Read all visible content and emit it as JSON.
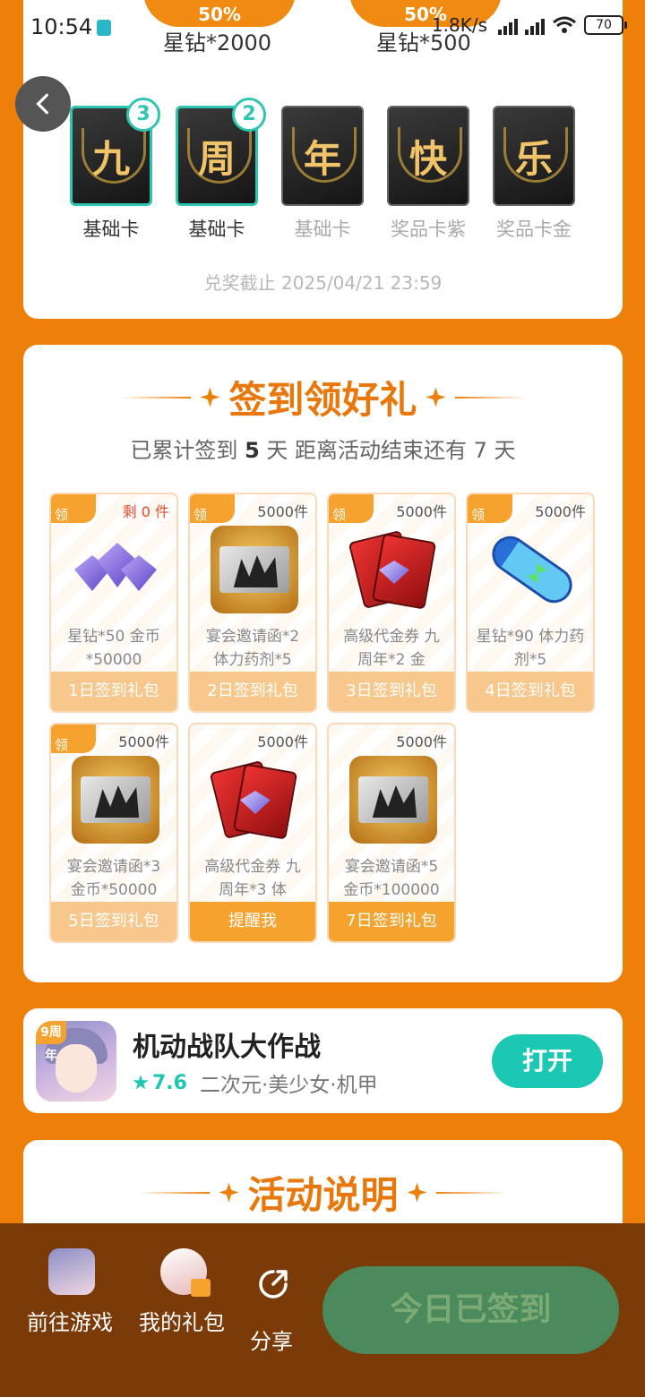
{
  "status_bar": {
    "time": "10:54",
    "net_speed": "1.8K/s",
    "battery": "70"
  },
  "top_card": {
    "discount_1": "50%",
    "discount_2": "50%",
    "reward_1": "星钻*2000",
    "reward_2": "星钻*500",
    "cards": [
      {
        "char": "九",
        "label": "基础卡",
        "count": "3",
        "owned": true
      },
      {
        "char": "周",
        "label": "基础卡",
        "count": "2",
        "owned": true
      },
      {
        "char": "年",
        "label": "基础卡",
        "owned": false
      },
      {
        "char": "快",
        "label": "奖品卡紫",
        "owned": false
      },
      {
        "char": "乐",
        "label": "奖品卡金",
        "owned": false
      }
    ],
    "deadline": "兑奖截止 2025/04/21 23:59"
  },
  "sign_section": {
    "title": "签到领好礼",
    "subtitle_prefix": "已累计签到 ",
    "days_signed": "5",
    "subtitle_mid": " 天  距离活动结束还有 7 天",
    "gifts": [
      {
        "tag": "领",
        "stock": "剩 0 件",
        "name": "星钻*50 金币*50000",
        "button": "1日签到礼包",
        "art": "diamond"
      },
      {
        "tag": "领",
        "stock": "5000件",
        "name": "宴会邀请函*2 体力药剂*5",
        "button": "2日签到礼包",
        "art": "invite"
      },
      {
        "tag": "领",
        "stock": "5000件",
        "name": "高级代金券 九周年*2 金",
        "button": "3日签到礼包",
        "art": "voucher"
      },
      {
        "tag": "领",
        "stock": "5000件",
        "name": "星钻*90 体力药剂*5",
        "button": "4日签到礼包",
        "art": "potion"
      },
      {
        "tag": "领",
        "stock": "5000件",
        "name": "宴会邀请函*3 金币*50000",
        "button": "5日签到礼包",
        "art": "invite"
      },
      {
        "tag": "",
        "stock": "5000件",
        "name": "高级代金券 九周年*3 体",
        "button": "提醒我",
        "art": "voucher"
      },
      {
        "tag": "",
        "stock": "5000件",
        "name": "宴会邀请函*5 金币*100000",
        "button": "7日签到礼包",
        "art": "invite"
      }
    ]
  },
  "game": {
    "badge": "9周年",
    "name": "机动战队大作战",
    "rating": "7.6",
    "tags": "二次元·美少女·机甲",
    "open_label": "打开"
  },
  "desc_section": {
    "title": "活动说明"
  },
  "bottom_bar": {
    "go_game": "前往游戏",
    "my_gifts": "我的礼包",
    "share": "分享",
    "signed": "今日已签到"
  },
  "colors": {
    "background": "#EE7F08",
    "accent_teal": "#1CC7B4",
    "signed_button": "#4B8A5C",
    "bottom_bar": "#7A3B08"
  }
}
